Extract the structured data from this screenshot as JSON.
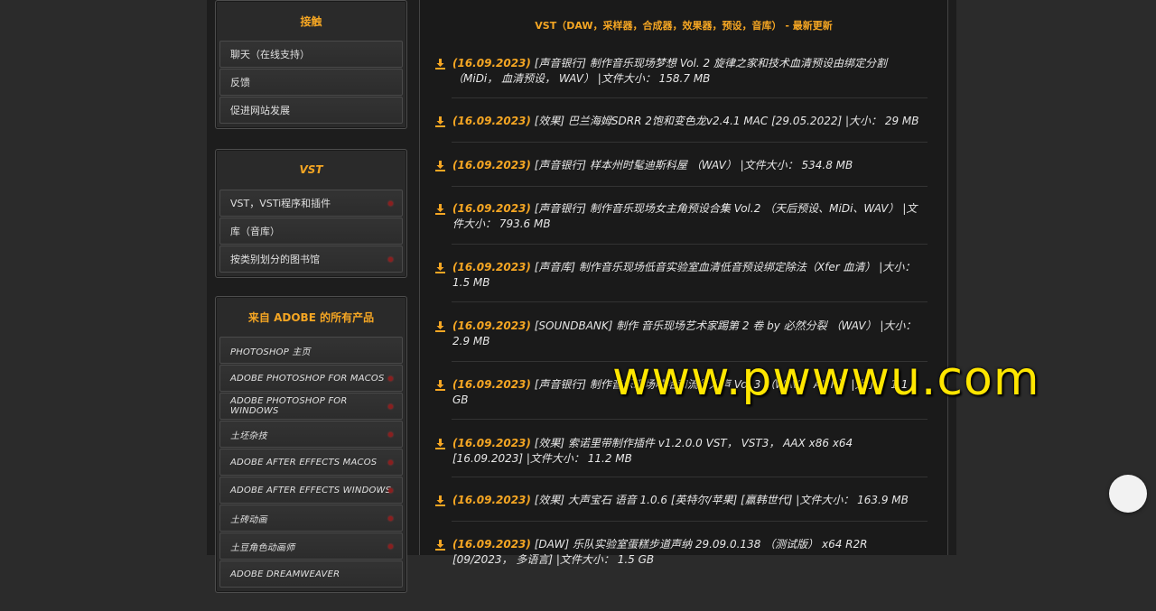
{
  "sidebar": {
    "contact": {
      "title": "接触",
      "items": [
        "聊天（在线支持）",
        "反馈",
        "促进网站发展"
      ]
    },
    "vst": {
      "title": "VST",
      "items": [
        "VST，VSTi程序和插件",
        "库（音库）",
        "按类别划分的图书馆"
      ]
    },
    "adobe": {
      "title": "来自 ADOBE 的所有产品",
      "items": [
        "PHOTOSHOP 主页",
        "ADOBE PHOTOSHOP FOR MACOS",
        "ADOBE PHOTOSHOP FOR WINDOWS",
        "土坯杂技",
        "ADOBE AFTER EFFECTS MACOS",
        "ADOBE AFTER EFFECTS WINDOWS",
        "土砖动画",
        "土豆角色动画师",
        "ADOBE DREAMWEAVER"
      ]
    }
  },
  "main": {
    "title": "VST（DAW，采样器，合成器，效果器，预设，音库） - 最新更新",
    "news": [
      {
        "date": "(16.09.2023)",
        "text": "[声音银行] 制作音乐现场梦想 Vol. 2 旋律之家和技术血清预设由绑定分割（MiDi， 血清预设， WAV） |文件大小： 158.7 MB"
      },
      {
        "date": "(16.09.2023)",
        "text": "[效果] 巴兰海姆SDRR 2饱和变色龙v2.4.1 MAC [29.05.2022] |大小： 29 MB"
      },
      {
        "date": "(16.09.2023)",
        "text": "[声音银行] 样本州时髦迪斯科屋 （WAV） |文件大小： 534.8 MB"
      },
      {
        "date": "(16.09.2023)",
        "text": "[声音银行] 制作音乐现场女主角预设合集 Vol.2 （天后预设、MiDi、WAV） |文件大小： 793.6 MB"
      },
      {
        "date": "(16.09.2023)",
        "text": "[声音库] 制作音乐现场低音实验室血清低音预设绑定除法（Xfer 血清） |大小： 1.5 MB"
      },
      {
        "date": "(16.09.2023)",
        "text": "[SOUNDBANK] 制作 音乐现场艺术家踢第 2 卷 by 必然分裂 （WAV） |大小： 2.9 MB"
      },
      {
        "date": "(16.09.2023)",
        "text": "[声音银行] 制作音乐现场嘻哈和流行人声 Vol 3 （WAV， AIFF） |大小： 1.1 GB"
      },
      {
        "date": "(16.09.2023)",
        "text": "[效果] 索诺里带制作插件 v1.2.0.0 VST， VST3， AAX x86 x64 [16.09.2023] |文件大小： 11.2 MB"
      },
      {
        "date": "(16.09.2023)",
        "text": "[效果] 大声宝石 语音 1.0.6 [英特尔/苹果] [赢韩世代] |文件大小： 163.9 MB"
      },
      {
        "date": "(16.09.2023)",
        "text": "[DAW] 乐队实验室蛋糕步道声纳 29.09.0.138 （测试版） x64 R2R [09/2023， 多语言] |文件大小： 1.5 GB"
      }
    ]
  },
  "watermark": "www.pwwwu.com",
  "colors": {
    "accent": "#f5a623",
    "background": "#2b2b2b"
  }
}
